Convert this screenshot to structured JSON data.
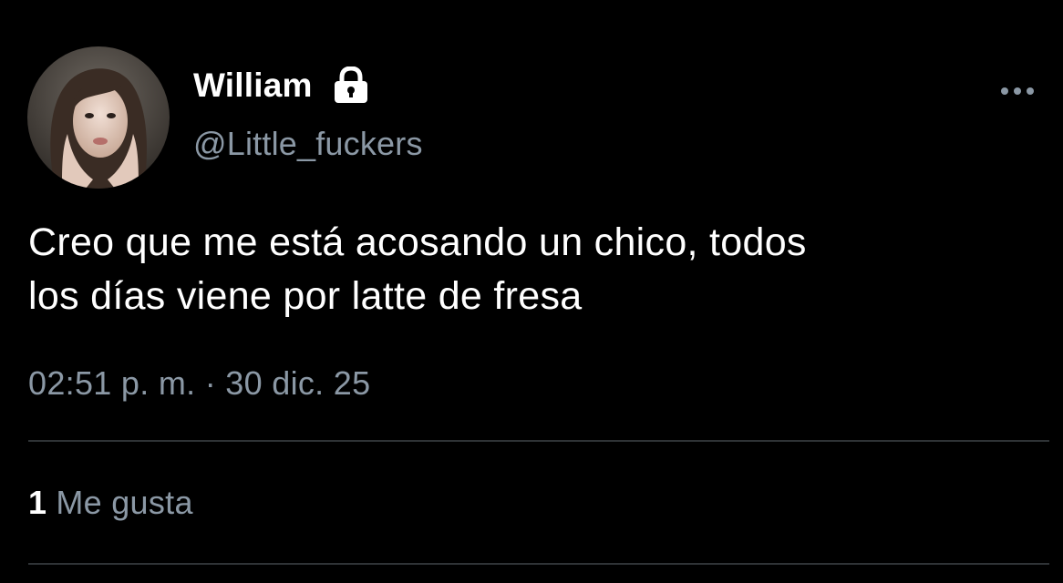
{
  "tweet": {
    "author": {
      "display_name": "William",
      "handle": "@Little_fuckers",
      "protected_icon": "lock-icon",
      "avatar_icon": "profile-photo"
    },
    "more_icon": "more-horizontal-icon",
    "text": "Creo que me está acosando un chico, todos\nlos días viene por latte de fresa",
    "timestamp": "02:51 p. m. · 30 dic. 25",
    "likes": {
      "count": "1",
      "label": "Me gusta"
    }
  },
  "colors": {
    "background": "#000000",
    "primary_text": "#ffffff",
    "secondary_text": "#8b98a5",
    "divider": "#2f3336"
  }
}
